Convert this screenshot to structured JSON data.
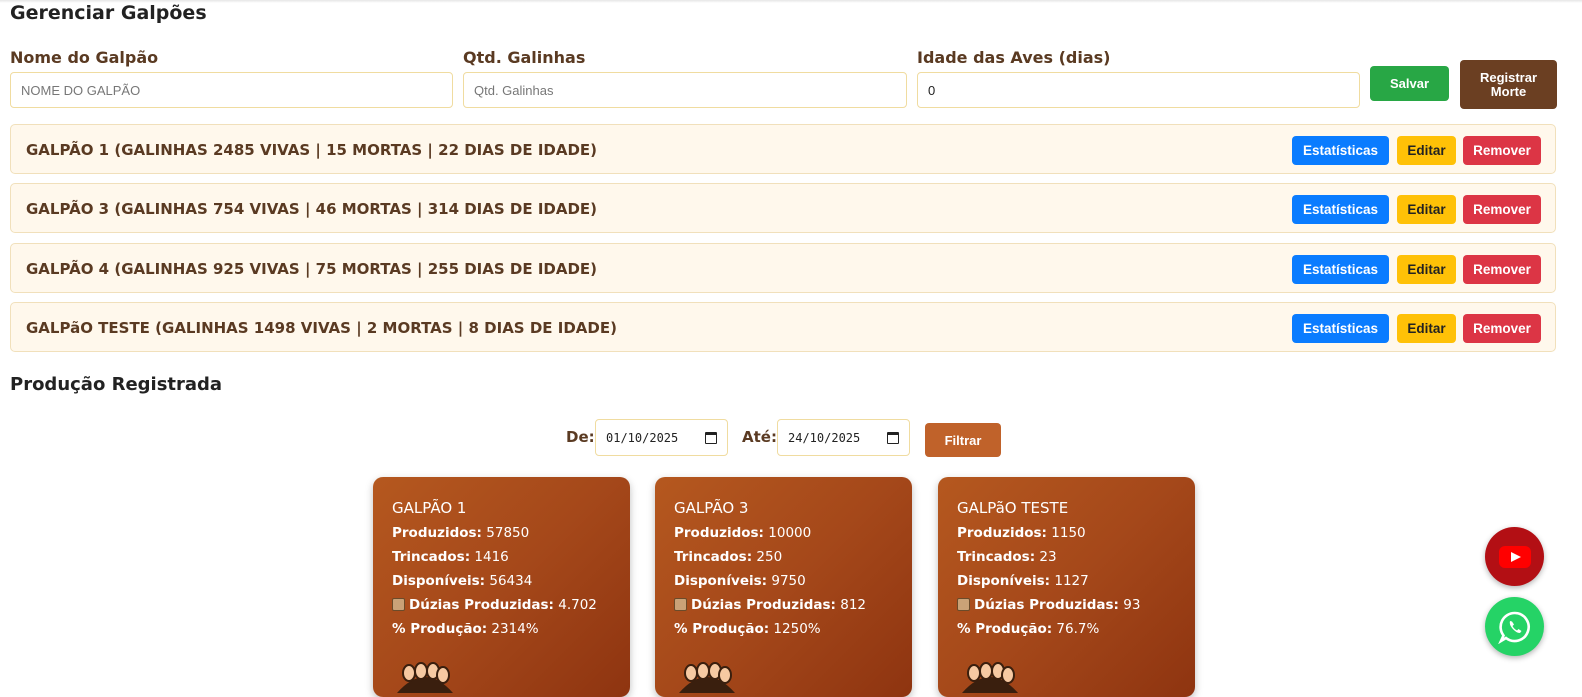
{
  "page": {
    "title": "Gerenciar Galpões"
  },
  "form": {
    "name_label": "Nome do Galpão",
    "name_placeholder": "NOME DO GALPÃO",
    "qty_label": "Qtd. Galinhas",
    "qty_placeholder": "Qtd. Galinhas",
    "age_label": "Idade das Aves (dias)",
    "age_value": "0",
    "save_label": "Salvar",
    "register_death_label": "Registrar Morte"
  },
  "sheds": [
    {
      "text": "GALPÃO 1 (GALINHAS 2485 VIVAS | 15 MORTAS | 22 DIAS DE IDADE)"
    },
    {
      "text": "GALPÃO 3 (GALINHAS 754 VIVAS | 46 MORTAS | 314 DIAS DE IDADE)"
    },
    {
      "text": "GALPÃO 4 (GALINHAS 925 VIVAS | 75 MORTAS | 255 DIAS DE IDADE)"
    },
    {
      "text": "GALPãO TESTE (GALINHAS 1498 VIVAS | 2 MORTAS | 8 DIAS DE IDADE)"
    }
  ],
  "shed_actions": {
    "stats": "Estatísticas",
    "edit": "Editar",
    "remove": "Remover"
  },
  "production": {
    "title": "Produção Registrada",
    "from_label": "De:",
    "from_value": "01/10/2025",
    "to_label": "Até:",
    "to_value": "24/10/2025",
    "filter_label": "Filtrar",
    "labels": {
      "produced": "Produzidos:",
      "cracked": "Trincados:",
      "available": "Disponíveis:",
      "dozens": "Dúzias Produzidas:",
      "percent": "% Produção:"
    },
    "cards": [
      {
        "name": "GALPÃO 1",
        "produced": "57850",
        "cracked": "1416",
        "available": "56434",
        "dozens": "4.702",
        "percent": "2314%"
      },
      {
        "name": "GALPÃO 3",
        "produced": "10000",
        "cracked": "250",
        "available": "9750",
        "dozens": "812",
        "percent": "1250%"
      },
      {
        "name": "GALPãO TESTE",
        "produced": "1150",
        "cracked": "23",
        "available": "1127",
        "dozens": "93",
        "percent": "76.7%"
      }
    ]
  },
  "colors": {
    "accent_brown": "#6b3f22",
    "save_green": "#28a745",
    "stats_blue": "#0a7cff",
    "edit_yellow": "#ffc107",
    "remove_red": "#dc3545",
    "filter_orange": "#c0622a",
    "youtube_red": "#b30f14",
    "whatsapp_green": "#25d366"
  },
  "icons": {
    "youtube": "youtube-icon",
    "whatsapp": "whatsapp-icon",
    "crate": "egg-crate-icon",
    "calendar": "calendar-icon"
  }
}
